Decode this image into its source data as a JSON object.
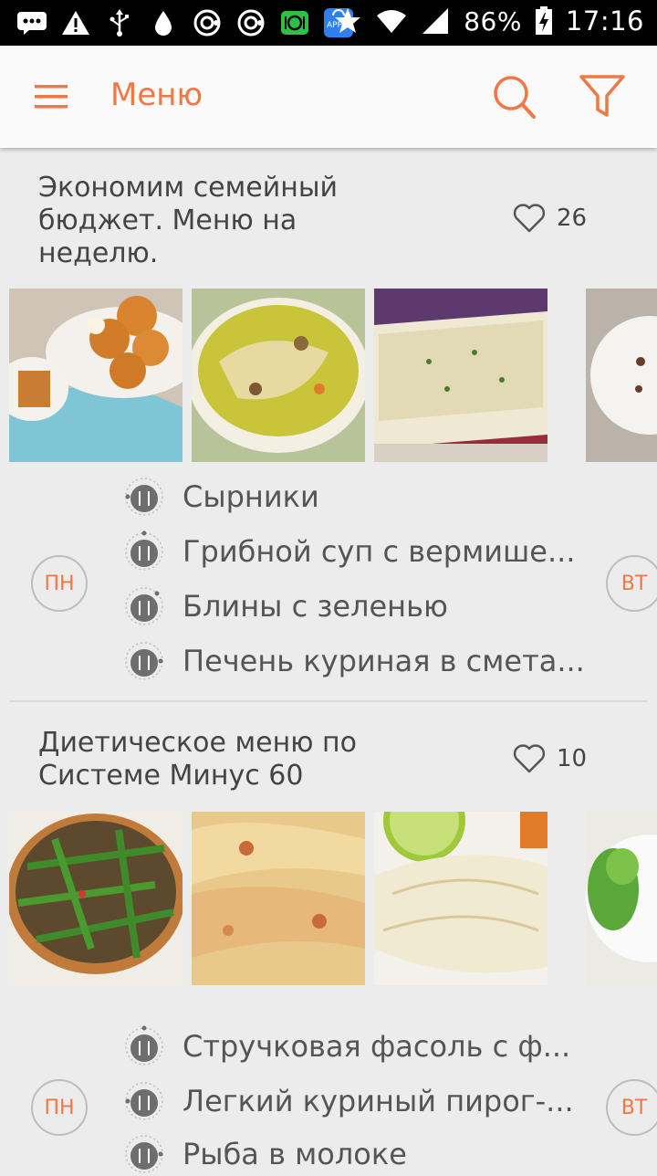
{
  "status_bar": {
    "battery": "86%",
    "time": "17:16",
    "app_badge": "APP"
  },
  "app_bar": {
    "title": "Меню"
  },
  "menus": [
    {
      "title": "Экономим семейный бюджет. Меню на неделю.",
      "likes": "26",
      "day_current": "ПН",
      "day_next": "ВТ",
      "dishes": [
        "Сырники",
        "Грибной суп с вермише...",
        "Блины с зеленью",
        "Печень куриная в смета..."
      ]
    },
    {
      "title": "Диетическое меню по Системе Минус 60",
      "likes": "10",
      "day_current": "ПН",
      "day_next": "ВТ",
      "dishes": [
        "Стручковая фасоль с ф...",
        "Легкий куриный пирог-...",
        "Рыба в молоке"
      ]
    }
  ],
  "colors": {
    "accent": "#f07845",
    "background": "#ececec",
    "appbar": "#fafafa",
    "text": "#444444"
  }
}
